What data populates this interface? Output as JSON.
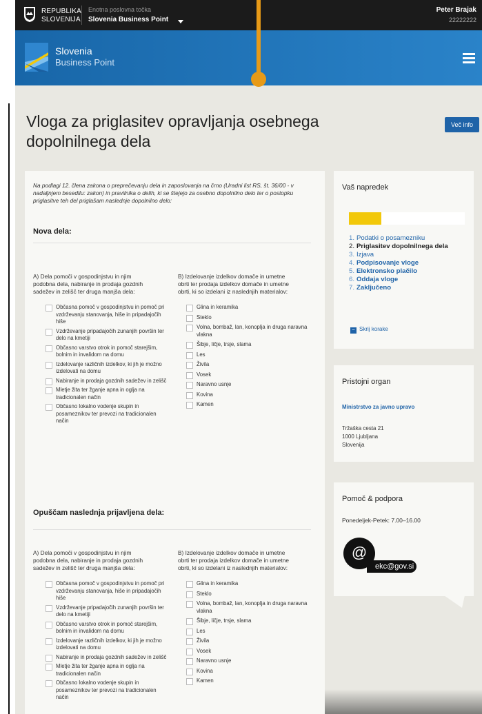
{
  "header": {
    "country_line1": "REPUBLIKA",
    "country_line2": "SLOVENIJA",
    "unit_label": "Enotna poslovna točka",
    "unit_value": "Slovenia Business Point",
    "user_name": "Peter Brajak",
    "user_id": "22222222"
  },
  "banner": {
    "logo_line1": "Slovenia",
    "logo_line2": "Business Point"
  },
  "page": {
    "title": "Vloga za priglasitev opravljanja osebnega dopolnilnega dela",
    "info_button": "Več info"
  },
  "form": {
    "intro": "Na podlagi 12. člena zakona o preprečevanju dela in zaposlovanja na črno (Uradni list RS, št. 36/00 - v nadaljnjem besedilu: zakon) in pravilnika o delih, ki se štejejo za osebno dopolnilno delo ter o postopku priglasitve teh del priglašam naslednje dopolnilno delo:",
    "section_new": "Nova dela:",
    "section_drop": "Opuščam naslednja prijavljena dela:",
    "col_a_head": "A) Dela pomoči v gospodinjstvu in njim podobna dela, nabiranje in prodaja gozdnih sadežev in zelišč ter druga manjša dela:",
    "col_b_head": "B) Izdelovanje izdelkov domače in umetne obrti ter prodaja izdelkov domače in umetne obrti, ki so izdelani iz naslednjih materialov:",
    "col_a_items": [
      "Občasna pomoč v gospodinjstvu in pomoč pri vzdrževanju stanovanja, hiše in pripadajočih zunanjih površin",
      "Vzdrževanje pripadajočih zunanjih površin ter delo na kmetiji",
      "Občasno varstvo otrok in pomoč starejšim, bolnim in invalidom na domu",
      "Izdelovanje različnih izdelkov, ki jih je možno izdelovati na domu",
      "Nabiranje in prodaja gozdnih sadežev in zelišč",
      "Mletje žita ter žganje apna in oglja na tradicionalen način",
      "Občasno lokalno vodenje skupin in posameznikov ter prevozi na tradicionalen način"
    ],
    "col_a_items_display": [
      "Občasna pomoč v gospodinjstvu in pomoč pri vzdrževanju stanovanja, hiše in pripadajočih hiše",
      "Vzdrževanje pripadajočih zunanjih površin ter delo na kmetiji",
      "Občasno varstvo otrok in pomoč starejšim, bolnim in invalidom na domu",
      "Izdelovanje različnih izdelkov, ki jih je možno izdelovati na domu",
      "Nabiranje in prodaja gozdnih sadežev in zelišč",
      "Mletje žita ter žganje apna in oglja na tradicionalen način",
      "Občasno lokalno vodenje skupin in posameznikov ter prevozi na tradicionalen način"
    ],
    "col_b_items": [
      "Glina in keramika",
      "Steklo",
      "Volna, bombaž, lan, konoplja in druga naravna vlakna",
      "Šibje, ličje, trsje, slama",
      "Les",
      "Živila",
      "Vosek",
      "Naravno usnje",
      "Kovina",
      "Kamen"
    ]
  },
  "progress": {
    "title": "Vaš napredek",
    "percent": 28,
    "steps": [
      {
        "num": "1.",
        "label": "Podatki o posamezniku"
      },
      {
        "num": "2.",
        "label": "Priglasitev dopolnilnega dela"
      },
      {
        "num": "3.",
        "label": "Izjava"
      },
      {
        "num": "4.",
        "label": "Podpisovanje vloge"
      },
      {
        "num": "5.",
        "label": "Elektronsko plačilo"
      },
      {
        "num": "6.",
        "label": "Oddaja vloge"
      },
      {
        "num": "7.",
        "label": "Zaključeno"
      }
    ],
    "hide_steps": "Skrij korake"
  },
  "authority": {
    "title": "Pristojni organ",
    "name": "Ministrstvo za javno upravo",
    "street": "Tržaška cesta 21",
    "city": "1000 Ljubljana",
    "country": "Slovenija"
  },
  "help": {
    "title": "Pomoč & podpora",
    "hours": "Ponedeljek-Petek: 7.00–16.00",
    "at_symbol": "@",
    "email": "ekc@gov.si"
  },
  "colors": {
    "accent_blue": "#1f63a8",
    "progress_yellow": "#f2c80a",
    "pointer_orange": "#e89a17",
    "top_bar": "#1b1b1b"
  }
}
